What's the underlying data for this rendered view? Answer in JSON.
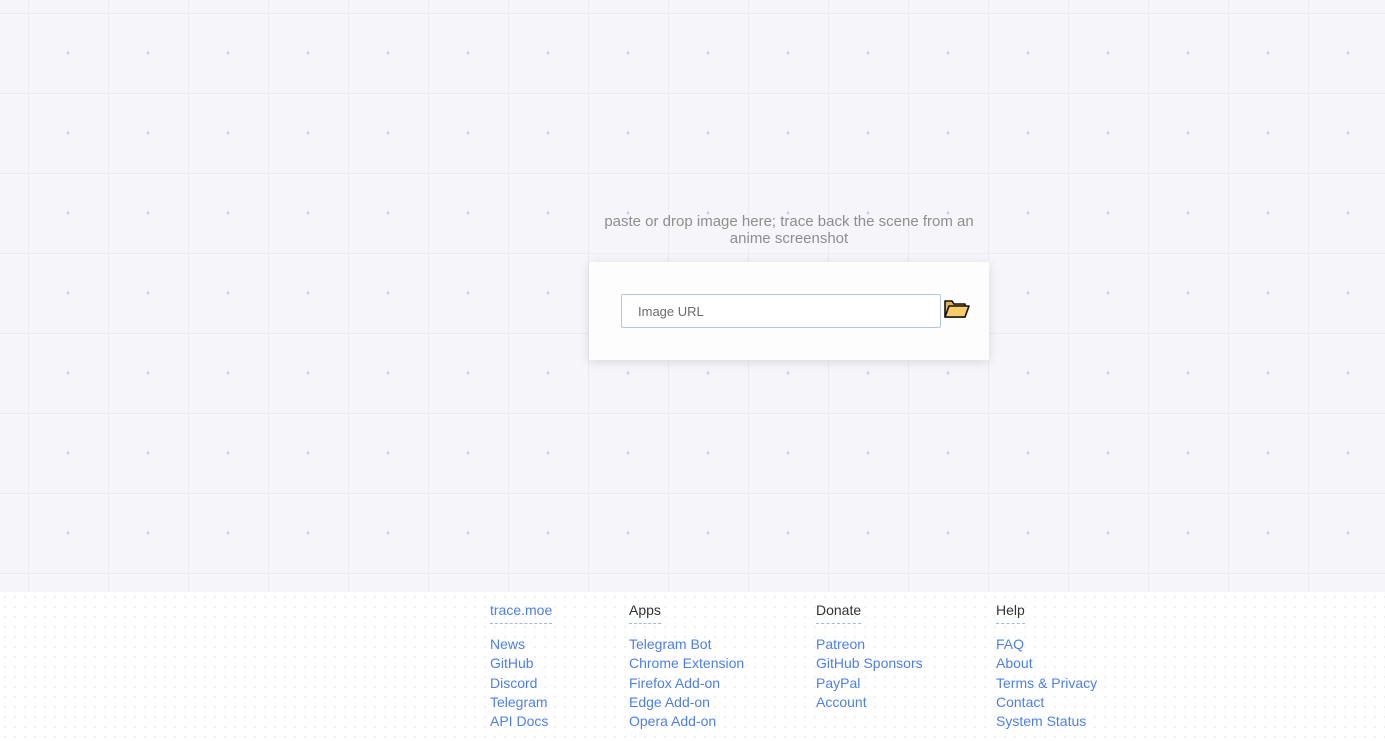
{
  "upload": {
    "hint": "paste or drop image here; trace back the scene from an anime screenshot",
    "url_placeholder": "Image URL",
    "folder_icon": "folder-open-icon"
  },
  "footer": {
    "columns": [
      {
        "title": "trace.moe",
        "title_is_link": true,
        "links": [
          "News",
          "GitHub",
          "Discord",
          "Telegram",
          "API Docs"
        ]
      },
      {
        "title": "Apps",
        "title_is_link": false,
        "links": [
          "Telegram Bot",
          "Chrome Extension",
          "Firefox Add-on",
          "Edge Add-on",
          "Opera Add-on"
        ]
      },
      {
        "title": "Donate",
        "title_is_link": false,
        "links": [
          "Patreon",
          "GitHub Sponsors",
          "PayPal",
          "Account"
        ]
      },
      {
        "title": "Help",
        "title_is_link": false,
        "links": [
          "FAQ",
          "About",
          "Terms & Privacy",
          "Contact",
          "System Status"
        ]
      }
    ]
  },
  "colors": {
    "link": "#4d7fe8",
    "background": "#f5f5fa",
    "folder": "#f7cc6a"
  }
}
